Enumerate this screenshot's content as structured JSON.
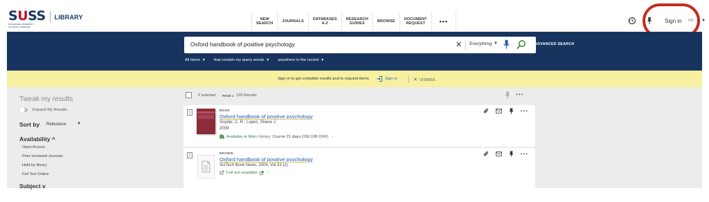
{
  "header": {
    "logo_text": "SUSS",
    "logo_subtitle": "SINGAPORE UNIVERSITY OF SOCIAL SCIENCES",
    "library_label": "LIBRARY",
    "nav": [
      {
        "label_line1": "NEW",
        "label_line2": "SEARCH"
      },
      {
        "label_line1": "JOURNALS",
        "label_line2": ""
      },
      {
        "label_line1": "DATABASES",
        "label_line2": "A-Z"
      },
      {
        "label_line1": "RESEARCH",
        "label_line2": "GUIDES"
      },
      {
        "label_line1": "BROWSE",
        "label_line2": ""
      },
      {
        "label_line1": "DOCUMENT",
        "label_line2": "REQUEST"
      },
      {
        "label_line1": "•••",
        "label_line2": ""
      }
    ],
    "sign_in": "Sign in",
    "language": "Me",
    "annotation_color": "#c62a1e"
  },
  "search": {
    "query": "Oxford handbook of positive psychology",
    "scope": "Everything",
    "advanced": "ADVANCED SEARCH",
    "filters": [
      "All items",
      "that contain my query words",
      "anywhere in the record"
    ]
  },
  "banner": {
    "text": "Sign in to get complete results and to request items",
    "sign_in": "Sign in",
    "dismiss": "DISMISS"
  },
  "sidebar": {
    "title": "Tweak my results",
    "expand": "Expand My Results",
    "sort_label": "Sort by",
    "sort_value": "Relevance",
    "availability_title": "Availability ^",
    "availability_items": [
      "Open Access",
      "Peer-reviewed Journals",
      "Held by library",
      "Full Text Online"
    ],
    "subject_title": "Subject v"
  },
  "results": {
    "selected": "0 selected",
    "page": "PAGE 1",
    "count": "139 Results",
    "items": [
      {
        "number": "1",
        "type": "BOOK",
        "title": "Oxford handbook of positive psychology",
        "authors": "Snyder, C. R.; Lopez, Shane J.",
        "year": "2009",
        "availability": "Available at Main Library",
        "availability_extra": "Course 21 days  (150.198 OXF)"
      },
      {
        "number": "2",
        "type": "REVIEW",
        "title": "Oxford handbook of positive psychology",
        "source": "SciTech Book News, 2009, Vol.33 (2)",
        "availability": "Full text available"
      }
    ]
  }
}
